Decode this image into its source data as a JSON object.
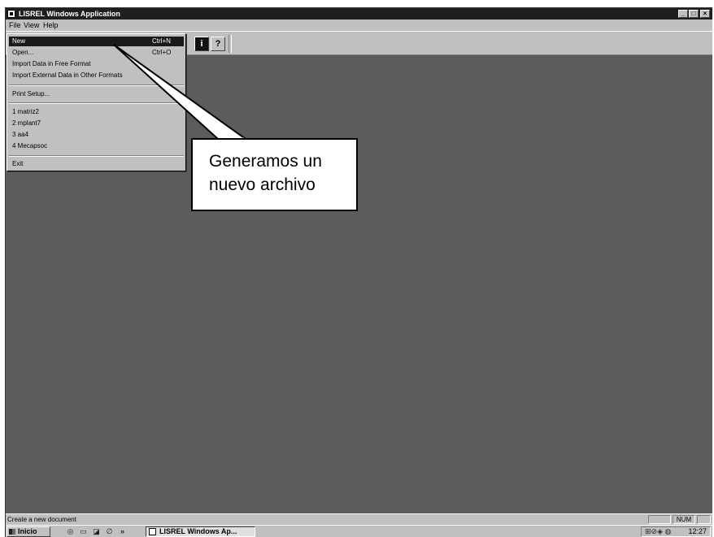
{
  "window": {
    "title": "LISREL Windows Application",
    "controls": [
      "_",
      "□",
      "×"
    ]
  },
  "menubar": {
    "items": [
      "File",
      "View",
      "Help"
    ]
  },
  "toolbar": {
    "buttons": [
      "?",
      "i",
      "?"
    ]
  },
  "file_menu": {
    "items": [
      {
        "label": "New",
        "shortcut": "Ctrl+N",
        "selected": true
      },
      {
        "label": "Open...",
        "shortcut": "Ctrl+O"
      },
      {
        "label": "Import Data in Free Format",
        "shortcut": ""
      },
      {
        "label": "Import External Data in Other Formats",
        "shortcut": ""
      },
      {
        "label": "Print Setup...",
        "shortcut": ""
      },
      {
        "label": "1 matriz2",
        "shortcut": ""
      },
      {
        "label": "2 mplant7",
        "shortcut": ""
      },
      {
        "label": "3 aa4",
        "shortcut": ""
      },
      {
        "label": "4 Mecapsoc",
        "shortcut": ""
      },
      {
        "label": "Exit",
        "shortcut": ""
      }
    ]
  },
  "callout": {
    "line1": "Generamos un",
    "line2": "nuevo archivo"
  },
  "statusbar": {
    "text": "Create a new document",
    "num_indicator": "NUM"
  },
  "taskbar": {
    "start_label": "Inicio",
    "quicklaunch_more": "»",
    "task_button": "LISREL Windows Ap...",
    "clock": "12:27"
  }
}
